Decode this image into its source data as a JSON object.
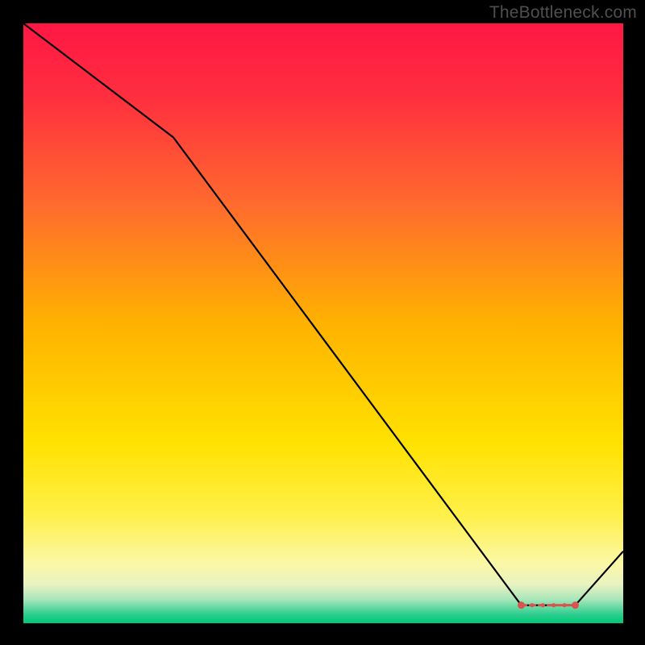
{
  "watermark": "TheBottleneck.com",
  "chart_data": {
    "type": "line",
    "title": "",
    "xlabel": "",
    "ylabel": "",
    "xlim": [
      0,
      100
    ],
    "ylim": [
      0,
      100
    ],
    "x": [
      0,
      25,
      83,
      92,
      100
    ],
    "values": [
      100,
      81,
      3,
      3,
      12
    ],
    "markers": {
      "x_range": [
        83,
        92
      ],
      "y": 3,
      "color": "#d9534f"
    },
    "background_gradient": {
      "stops": [
        {
          "offset": 0.0,
          "color": "#ff1744"
        },
        {
          "offset": 0.12,
          "color": "#ff2e3f"
        },
        {
          "offset": 0.3,
          "color": "#ff6a2e"
        },
        {
          "offset": 0.5,
          "color": "#ffb200"
        },
        {
          "offset": 0.7,
          "color": "#ffe200"
        },
        {
          "offset": 0.82,
          "color": "#fff04a"
        },
        {
          "offset": 0.9,
          "color": "#fbf8a6"
        },
        {
          "offset": 0.935,
          "color": "#e9f2c0"
        },
        {
          "offset": 0.96,
          "color": "#a9e6bb"
        },
        {
          "offset": 0.985,
          "color": "#2ecf8f"
        },
        {
          "offset": 1.0,
          "color": "#00c776"
        }
      ]
    },
    "line_color": "#000000",
    "line_width": 2.2
  }
}
